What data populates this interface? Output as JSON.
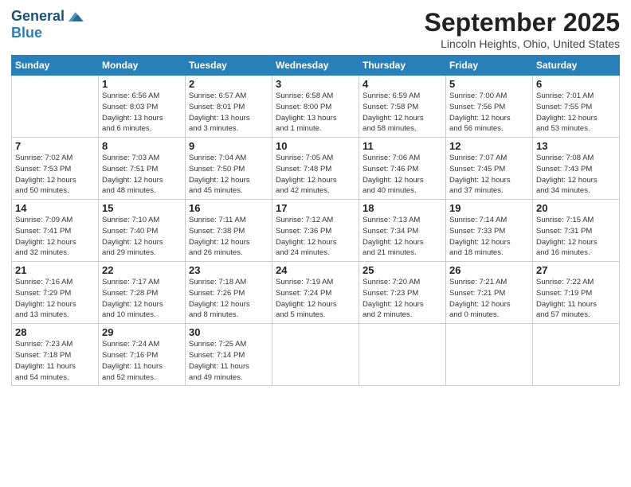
{
  "header": {
    "logo_line1": "General",
    "logo_line2": "Blue",
    "month": "September 2025",
    "location": "Lincoln Heights, Ohio, United States"
  },
  "weekdays": [
    "Sunday",
    "Monday",
    "Tuesday",
    "Wednesday",
    "Thursday",
    "Friday",
    "Saturday"
  ],
  "weeks": [
    [
      {
        "day": "",
        "info": ""
      },
      {
        "day": "1",
        "info": "Sunrise: 6:56 AM\nSunset: 8:03 PM\nDaylight: 13 hours\nand 6 minutes."
      },
      {
        "day": "2",
        "info": "Sunrise: 6:57 AM\nSunset: 8:01 PM\nDaylight: 13 hours\nand 3 minutes."
      },
      {
        "day": "3",
        "info": "Sunrise: 6:58 AM\nSunset: 8:00 PM\nDaylight: 13 hours\nand 1 minute."
      },
      {
        "day": "4",
        "info": "Sunrise: 6:59 AM\nSunset: 7:58 PM\nDaylight: 12 hours\nand 58 minutes."
      },
      {
        "day": "5",
        "info": "Sunrise: 7:00 AM\nSunset: 7:56 PM\nDaylight: 12 hours\nand 56 minutes."
      },
      {
        "day": "6",
        "info": "Sunrise: 7:01 AM\nSunset: 7:55 PM\nDaylight: 12 hours\nand 53 minutes."
      }
    ],
    [
      {
        "day": "7",
        "info": "Sunrise: 7:02 AM\nSunset: 7:53 PM\nDaylight: 12 hours\nand 50 minutes."
      },
      {
        "day": "8",
        "info": "Sunrise: 7:03 AM\nSunset: 7:51 PM\nDaylight: 12 hours\nand 48 minutes."
      },
      {
        "day": "9",
        "info": "Sunrise: 7:04 AM\nSunset: 7:50 PM\nDaylight: 12 hours\nand 45 minutes."
      },
      {
        "day": "10",
        "info": "Sunrise: 7:05 AM\nSunset: 7:48 PM\nDaylight: 12 hours\nand 42 minutes."
      },
      {
        "day": "11",
        "info": "Sunrise: 7:06 AM\nSunset: 7:46 PM\nDaylight: 12 hours\nand 40 minutes."
      },
      {
        "day": "12",
        "info": "Sunrise: 7:07 AM\nSunset: 7:45 PM\nDaylight: 12 hours\nand 37 minutes."
      },
      {
        "day": "13",
        "info": "Sunrise: 7:08 AM\nSunset: 7:43 PM\nDaylight: 12 hours\nand 34 minutes."
      }
    ],
    [
      {
        "day": "14",
        "info": "Sunrise: 7:09 AM\nSunset: 7:41 PM\nDaylight: 12 hours\nand 32 minutes."
      },
      {
        "day": "15",
        "info": "Sunrise: 7:10 AM\nSunset: 7:40 PM\nDaylight: 12 hours\nand 29 minutes."
      },
      {
        "day": "16",
        "info": "Sunrise: 7:11 AM\nSunset: 7:38 PM\nDaylight: 12 hours\nand 26 minutes."
      },
      {
        "day": "17",
        "info": "Sunrise: 7:12 AM\nSunset: 7:36 PM\nDaylight: 12 hours\nand 24 minutes."
      },
      {
        "day": "18",
        "info": "Sunrise: 7:13 AM\nSunset: 7:34 PM\nDaylight: 12 hours\nand 21 minutes."
      },
      {
        "day": "19",
        "info": "Sunrise: 7:14 AM\nSunset: 7:33 PM\nDaylight: 12 hours\nand 18 minutes."
      },
      {
        "day": "20",
        "info": "Sunrise: 7:15 AM\nSunset: 7:31 PM\nDaylight: 12 hours\nand 16 minutes."
      }
    ],
    [
      {
        "day": "21",
        "info": "Sunrise: 7:16 AM\nSunset: 7:29 PM\nDaylight: 12 hours\nand 13 minutes."
      },
      {
        "day": "22",
        "info": "Sunrise: 7:17 AM\nSunset: 7:28 PM\nDaylight: 12 hours\nand 10 minutes."
      },
      {
        "day": "23",
        "info": "Sunrise: 7:18 AM\nSunset: 7:26 PM\nDaylight: 12 hours\nand 8 minutes."
      },
      {
        "day": "24",
        "info": "Sunrise: 7:19 AM\nSunset: 7:24 PM\nDaylight: 12 hours\nand 5 minutes."
      },
      {
        "day": "25",
        "info": "Sunrise: 7:20 AM\nSunset: 7:23 PM\nDaylight: 12 hours\nand 2 minutes."
      },
      {
        "day": "26",
        "info": "Sunrise: 7:21 AM\nSunset: 7:21 PM\nDaylight: 12 hours\nand 0 minutes."
      },
      {
        "day": "27",
        "info": "Sunrise: 7:22 AM\nSunset: 7:19 PM\nDaylight: 11 hours\nand 57 minutes."
      }
    ],
    [
      {
        "day": "28",
        "info": "Sunrise: 7:23 AM\nSunset: 7:18 PM\nDaylight: 11 hours\nand 54 minutes."
      },
      {
        "day": "29",
        "info": "Sunrise: 7:24 AM\nSunset: 7:16 PM\nDaylight: 11 hours\nand 52 minutes."
      },
      {
        "day": "30",
        "info": "Sunrise: 7:25 AM\nSunset: 7:14 PM\nDaylight: 11 hours\nand 49 minutes."
      },
      {
        "day": "",
        "info": ""
      },
      {
        "day": "",
        "info": ""
      },
      {
        "day": "",
        "info": ""
      },
      {
        "day": "",
        "info": ""
      }
    ]
  ]
}
